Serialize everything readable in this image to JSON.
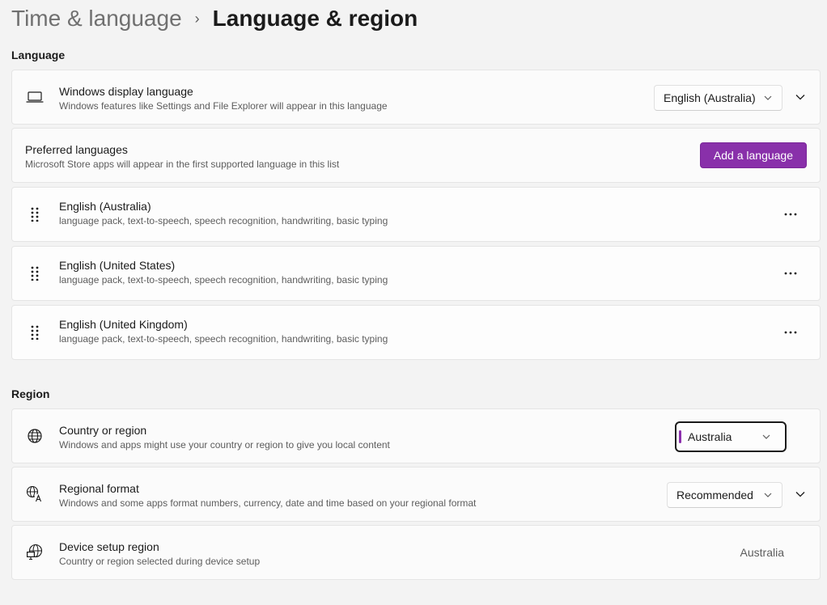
{
  "breadcrumb": {
    "parent": "Time & language",
    "separator": "›",
    "current": "Language & region"
  },
  "language_section": {
    "title": "Language",
    "display_language": {
      "title": "Windows display language",
      "description": "Windows features like Settings and File Explorer will appear in this language",
      "selected": "English (Australia)",
      "icon": "laptop-icon"
    },
    "preferred": {
      "title": "Preferred languages",
      "description": "Microsoft Store apps will appear in the first supported language in this list",
      "add_button": "Add a language"
    },
    "languages": [
      {
        "name": "English (Australia)",
        "features": "language pack, text-to-speech, speech recognition, handwriting, basic typing"
      },
      {
        "name": "English (United States)",
        "features": "language pack, text-to-speech, speech recognition, handwriting, basic typing"
      },
      {
        "name": "English (United Kingdom)",
        "features": "language pack, text-to-speech, speech recognition, handwriting, basic typing"
      }
    ]
  },
  "region_section": {
    "title": "Region",
    "country": {
      "title": "Country or region",
      "description": "Windows and apps might use your country or region to give you local content",
      "selected": "Australia",
      "icon": "globe-icon"
    },
    "format": {
      "title": "Regional format",
      "description": "Windows and some apps format numbers, currency, date and time based on your regional format",
      "selected": "Recommended",
      "icon": "globe-language-icon"
    },
    "device_region": {
      "title": "Device setup region",
      "description": "Country or region selected during device setup",
      "value": "Australia",
      "icon": "globe-device-icon"
    }
  },
  "colors": {
    "accent": "#8930aa",
    "background": "#f3f3f3",
    "card": "#fbfbfb"
  }
}
